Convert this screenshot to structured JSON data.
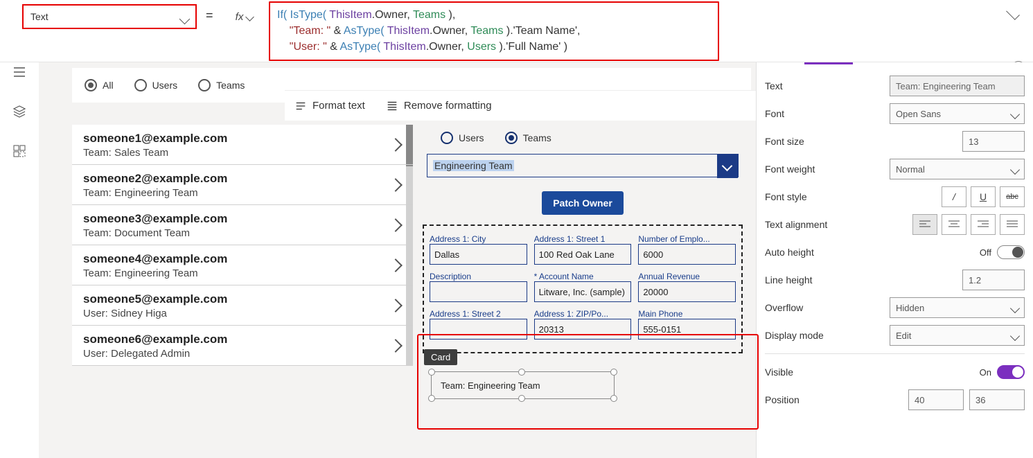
{
  "propertyDropdown": "Text",
  "formula": {
    "line1a": "If( ",
    "line1b": "IsType( ",
    "line1c": "ThisItem",
    "line1d": ".Owner, ",
    "line1e": "Teams ",
    "line1f": "),",
    "line2a": "    ",
    "line2b": "\"Team: \" ",
    "line2c": "& ",
    "line2d": "AsType( ",
    "line2e": "ThisItem",
    "line2f": ".Owner, ",
    "line2g": "Teams ",
    "line2h": ").'Team Name',",
    "line3a": "    ",
    "line3b": "\"User: \" ",
    "line3c": "& ",
    "line3d": "AsType( ",
    "line3e": "ThisItem",
    "line3f": ".Owner, ",
    "line3g": "Users ",
    "line3h": ").'Full Name' )"
  },
  "toolbar": {
    "format": "Format text",
    "remove": "Remove formatting"
  },
  "filter": {
    "all": "All",
    "users": "Users",
    "teams": "Teams"
  },
  "gallery": [
    {
      "email": "someone1@example.com",
      "sub": "Team: Sales Team"
    },
    {
      "email": "someone2@example.com",
      "sub": "Team: Engineering Team"
    },
    {
      "email": "someone3@example.com",
      "sub": "Team: Document Team"
    },
    {
      "email": "someone4@example.com",
      "sub": "Team: Engineering Team"
    },
    {
      "email": "someone5@example.com",
      "sub": "User: Sidney Higa"
    },
    {
      "email": "someone6@example.com",
      "sub": "User: Delegated Admin"
    }
  ],
  "detailRadio": {
    "users": "Users",
    "teams": "Teams"
  },
  "detailSelect": "Engineering Team",
  "patchBtn": "Patch Owner",
  "cardTooltip": "Card",
  "selectedCardText": "Team: Engineering Team",
  "formFields": [
    {
      "label": "Address 1: City",
      "value": "Dallas"
    },
    {
      "label": "Address 1: Street 1",
      "value": "100 Red Oak Lane"
    },
    {
      "label": "Number of Emplo...",
      "value": "6000"
    },
    {
      "label": "Description",
      "value": ""
    },
    {
      "label": "Account Name",
      "value": "Litware, Inc. (sample)",
      "req": true
    },
    {
      "label": "Annual Revenue",
      "value": "20000"
    },
    {
      "label": "Address 1: Street 2",
      "value": ""
    },
    {
      "label": "Address 1: ZIP/Po...",
      "value": "20313"
    },
    {
      "label": "Main Phone",
      "value": "555-0151"
    }
  ],
  "props": {
    "text_l": "Text",
    "text_v": "Team: Engineering Team",
    "font_l": "Font",
    "font_v": "Open Sans",
    "fontsize_l": "Font size",
    "fontsize_v": "13",
    "fontweight_l": "Font weight",
    "fontweight_v": "Normal",
    "fontstyle_l": "Font style",
    "align_l": "Text alignment",
    "autoh_l": "Auto height",
    "autoh_v": "Off",
    "lineh_l": "Line height",
    "lineh_v": "1.2",
    "overflow_l": "Overflow",
    "overflow_v": "Hidden",
    "display_l": "Display mode",
    "display_v": "Edit",
    "visible_l": "Visible",
    "visible_v": "On",
    "pos_l": "Position",
    "pos_x": "40",
    "pos_y": "36",
    "italic": "/",
    "underline": "U",
    "strike": "abc"
  }
}
